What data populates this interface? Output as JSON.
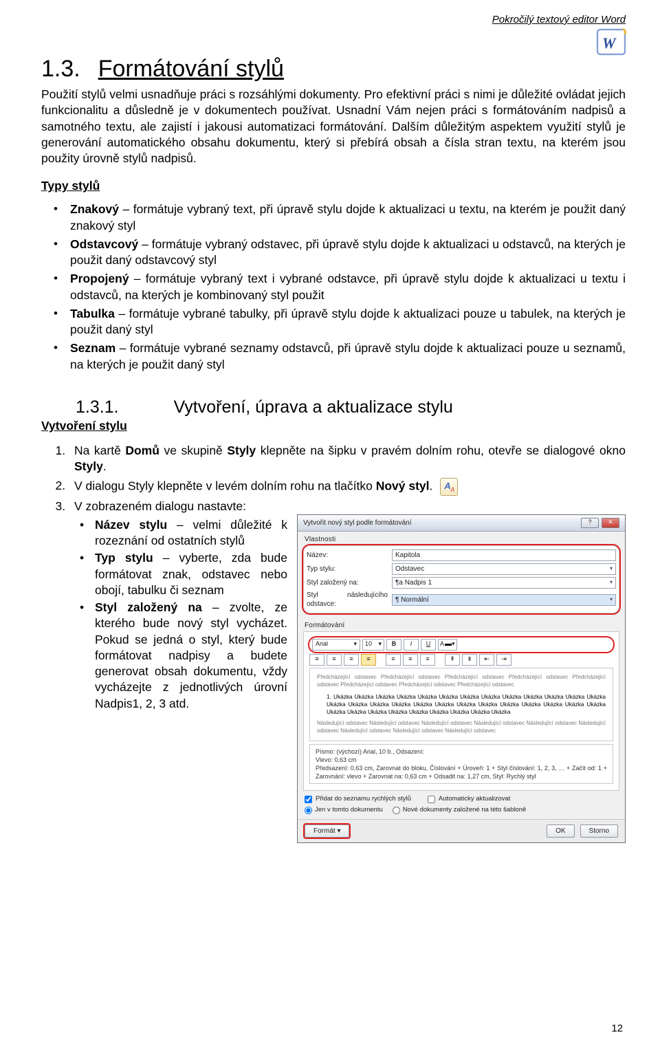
{
  "header": {
    "course": "Pokročilý textový editor Word"
  },
  "section": {
    "number": "1.3.",
    "title": "Formátování stylů",
    "intro": "Použití stylů velmi usnadňuje práci s rozsáhlými dokumenty. Pro efektivní práci s nimi je důležité ovládat jejich funkcionalitu a důsledně je v dokumentech používat. Usnadní Vám nejen práci s formátováním nadpisů a samotného textu, ale zajistí i jakousi automatizaci formátování. Dalším důležitým aspektem využití stylů je generování automatického obsahu dokumentu, který si přebírá obsah a čísla stran textu, na kterém jsou použity úrovně stylů nadpisů."
  },
  "types": {
    "heading": "Typy stylů",
    "items": [
      {
        "b": "Znakový",
        "t": " – formátuje vybraný text, při úpravě stylu dojde k aktualizaci u textu, na kterém je použit daný znakový styl"
      },
      {
        "b": "Odstavcový",
        "t": " – formátuje vybraný odstavec, při úpravě stylu dojde k aktualizaci u odstavců, na kterých je použit daný odstavcový styl"
      },
      {
        "b": "Propojený",
        "t": " – formátuje vybraný text i vybrané odstavce, při úpravě stylu dojde k aktualizaci u textu i odstavců, na kterých je kombinovaný styl použit"
      },
      {
        "b": "Tabulka",
        "t": " – formátuje vybrané tabulky, při úpravě stylu dojde k aktualizaci pouze u tabulek, na kterých je použit daný styl"
      },
      {
        "b": "Seznam",
        "t": " – formátuje vybrané seznamy odstavců, při úpravě stylu dojde k aktualizaci pouze u seznamů, na kterých je použit daný styl"
      }
    ]
  },
  "subsection": {
    "number": "1.3.1.",
    "title": "Vytvoření, úprava a aktualizace stylu",
    "subtitle": "Vytvoření stylu",
    "steps": {
      "s1_a": "Na kartě ",
      "s1_b": "Domů",
      "s1_c": " ve skupině ",
      "s1_d": "Styly",
      "s1_e": " klepněte na šipku v pravém dolním rohu, otevře se dialogové okno ",
      "s1_f": "Styly",
      "s1_g": ".",
      "s2_a": "V dialogu Styly klepněte v levém dolním rohu na tlačítko ",
      "s2_b": "Nový styl",
      "s2_c": ".",
      "s3": "V zobrazeném dialogu nastavte:",
      "inner": [
        {
          "b": "Název stylu",
          "t": " – velmi důležité k rozeznání od ostatních stylů"
        },
        {
          "b": "Typ stylu",
          "t": " – vyberte, zda bude formátovat znak, odstavec nebo obojí, tabulku či seznam"
        },
        {
          "b": "Styl založený na",
          "t": " – zvolte, ze kterého bude nový styl vycházet. Pokud se jedná o styl, který bude formátovat nadpisy a budete generovat obsah dokumentu, vždy vycházejte z jednotlivých úrovní Nadpis1, 2, 3 atd."
        }
      ]
    }
  },
  "dialog": {
    "title": "Vytvořit nový styl podle formátování",
    "help": "?",
    "close": "✕",
    "grp_props": "Vlastnosti",
    "lbl_name": "Název:",
    "val_name": "Kapitola",
    "lbl_type": "Typ stylu:",
    "val_type": "Odstavec",
    "lbl_based": "Styl založený na:",
    "val_based": "¶a Nadpis 1",
    "lbl_next": "Styl následujícího odstavce:",
    "val_next": "¶ Normální",
    "grp_fmt": "Formátování",
    "font": "Arial",
    "size": "10",
    "b": "B",
    "i": "I",
    "u": "U",
    "preview_grey": "Předcházející odstavec Předcházející odstavec Předcházející odstavec Předcházející odstavec Předcházející odstavec Předcházející odstavec Předcházející odstavec Předcházející odstavec",
    "preview_sample": "1.    Ukázka Ukázka Ukázka Ukázka Ukázka Ukázka Ukázka Ukázka Ukázka Ukázka Ukázka Ukázka Ukázka Ukázka Ukázka Ukázka Ukázka Ukázka Ukázka Ukázka Ukázka Ukázka Ukázka Ukázka Ukázka Ukázka Ukázka Ukázka Ukázka Ukázka Ukázka Ukázka Ukázka Ukázka Ukázka",
    "preview_grey2": "Následující odstavec Následující odstavec Následující odstavec Následující odstavec Následující odstavec Následující odstavec Následující odstavec Následující odstavec Následující odstavec",
    "meta": "Písmo: (výchozí) Arial, 10 b., Odsazení:\n    Vlevo: 0,63 cm\n    Předsazení: 0,63 cm, Zarovnat do bloku, Číslování + Úroveň: 1 + Styl číslování: 1, 2, 3, … + Začít od: 1 + Zarovnání: vlevo + Zarovnat na: 0,63 cm + Odsadit na: 1,27 cm, Styl: Rychlý styl",
    "chk1": "Přidat do seznamu rychlých stylů",
    "chk2": "Automaticky aktualizovat",
    "r1": "Jen v tomto dokumentu",
    "r2": "Nové dokumenty založené na této šabloně",
    "format_btn": "Formát ▾",
    "ok": "OK",
    "cancel": "Storno"
  },
  "page": "12"
}
